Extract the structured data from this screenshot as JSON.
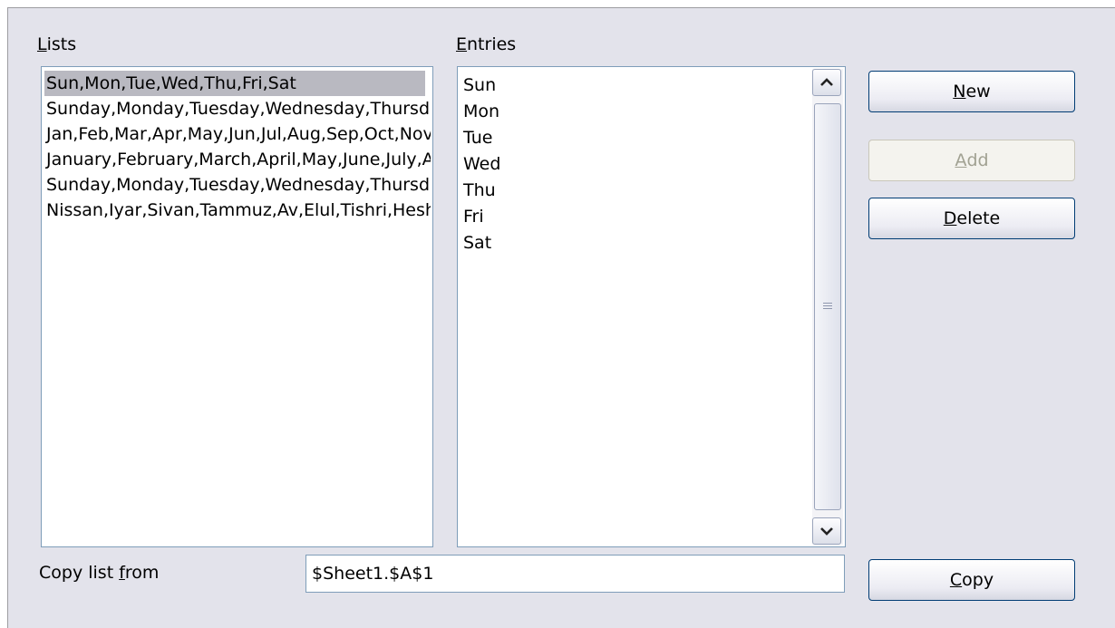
{
  "lists": {
    "label": "Lists",
    "items": [
      "Sun,Mon,Tue,Wed,Thu,Fri,Sat",
      "Sunday,Monday,Tuesday,Wednesday,Thursday,Friday,Saturday",
      "Jan,Feb,Mar,Apr,May,Jun,Jul,Aug,Sep,Oct,Nov,Dec",
      "January,February,March,April,May,June,July,August,September,October,November,December",
      "Sunday,Monday,Tuesday,Wednesday,Thursday,Friday,Saturday",
      "Nissan,Iyar,Sivan,Tammuz,Av,Elul,Tishri,Heshvan,Kislev,Tevet,Shevat,Adar,Adar B"
    ],
    "selected_index": 0
  },
  "entries": {
    "label": "Entries",
    "items": [
      "Sun",
      "Mon",
      "Tue",
      "Wed",
      "Thu",
      "Fri",
      "Sat"
    ]
  },
  "buttons": {
    "new": "New",
    "add": "Add",
    "delete": "Delete",
    "copy": "Copy"
  },
  "copy_from": {
    "label": "Copy list from",
    "value": "$Sheet1.$A$1"
  },
  "icons": {
    "scroll_up": "chevron-up-icon",
    "scroll_down": "chevron-down-icon",
    "thumb_grip": "grip-icon"
  },
  "colors": {
    "panel_bg": "#e3e3eb",
    "selection_bg": "#b9b9c1",
    "input_border": "#7f9db9"
  }
}
